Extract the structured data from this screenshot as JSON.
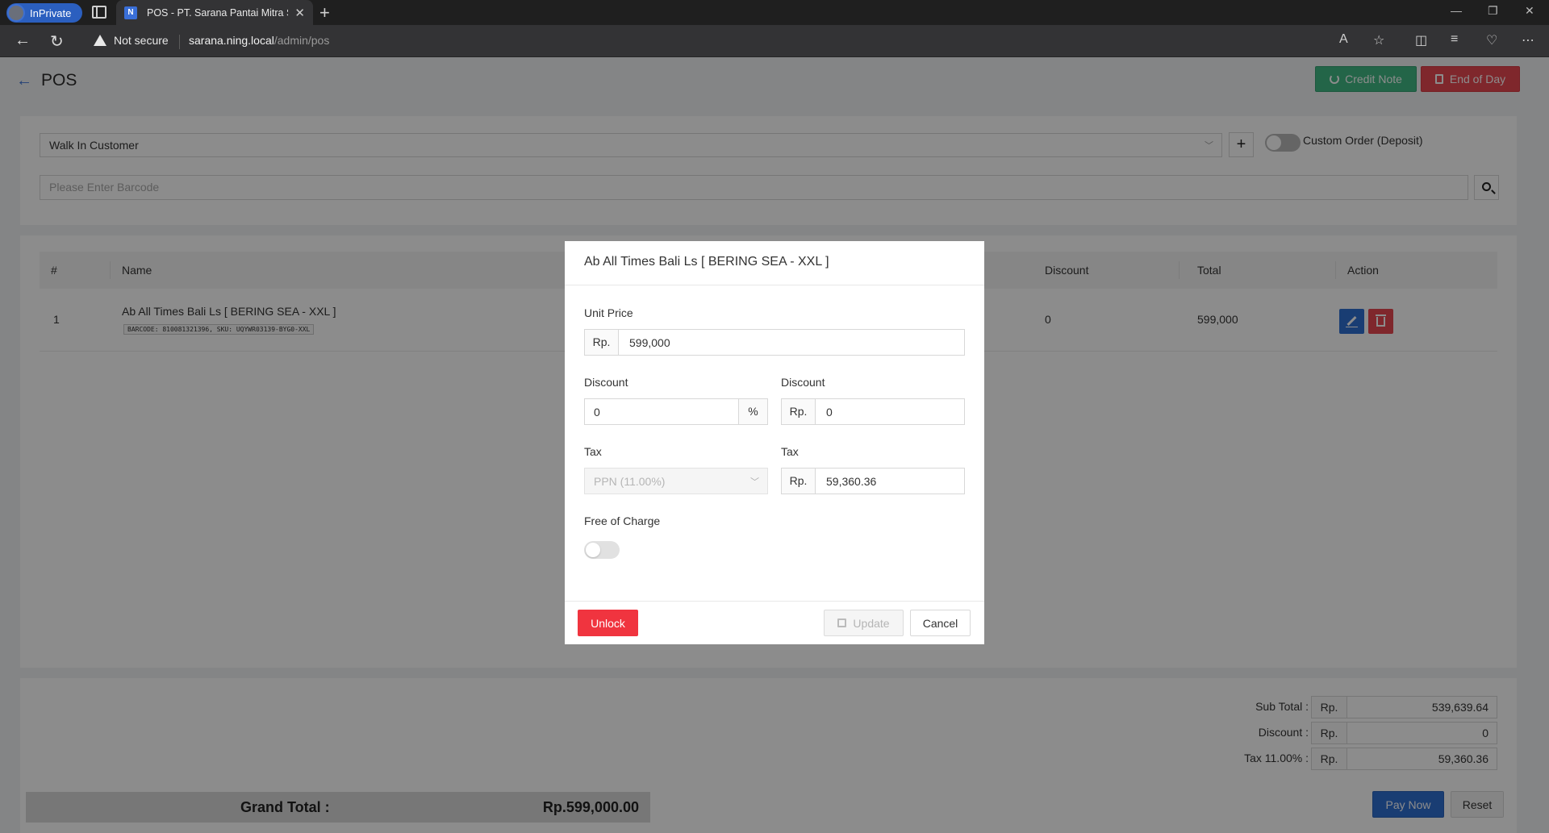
{
  "browser": {
    "inprivate_label": "InPrivate",
    "tab_title": "POS - PT. Sarana Pantai Mitra Se",
    "security_label": "Not secure",
    "url_host": "sarana.ning.local",
    "url_path": "/admin/pos"
  },
  "header": {
    "title": "POS",
    "credit_note_label": "Credit Note",
    "end_of_day_label": "End of Day"
  },
  "customer": {
    "selected": "Walk In Customer",
    "add_label": "+",
    "custom_order_label": "Custom Order (Deposit)"
  },
  "barcode": {
    "placeholder": "Please Enter Barcode"
  },
  "table": {
    "columns": {
      "num": "#",
      "name": "Name",
      "discount": "Discount",
      "total": "Total",
      "action": "Action"
    },
    "rows": [
      {
        "num": "1",
        "name": "Ab All Times Bali Ls [ BERING SEA - XXL ]",
        "meta": "BARCODE: 810081321396, SKU: UQYWR03139-BYG0-XXL",
        "discount": "0",
        "total": "599,000"
      }
    ]
  },
  "summary": {
    "subtotal_label": "Sub Total :",
    "discount_label": "Discount :",
    "tax_label": "Tax 11.00% :",
    "currency": "Rp.",
    "subtotal": "539,639.64",
    "discount": "0",
    "tax": "59,360.36",
    "grand_label": "Grand Total :",
    "grand_value": "Rp.599,000.00",
    "pay_label": "Pay Now",
    "reset_label": "Reset"
  },
  "modal": {
    "title": "Ab All Times Bali Ls [ BERING SEA - XXL ]",
    "unit_price_label": "Unit Price",
    "currency": "Rp.",
    "unit_price": "599,000",
    "discount_pct_label": "Discount",
    "discount_pct": "0",
    "pct_symbol": "%",
    "discount_amt_label": "Discount",
    "discount_amt": "0",
    "tax_select_label": "Tax",
    "tax_select_value": "PPN (11.00%)",
    "tax_amt_label": "Tax",
    "tax_amt": "59,360.36",
    "free_of_charge_label": "Free of Charge",
    "free_of_charge_on": false,
    "unlock_label": "Unlock",
    "update_label": "Update",
    "cancel_label": "Cancel"
  }
}
